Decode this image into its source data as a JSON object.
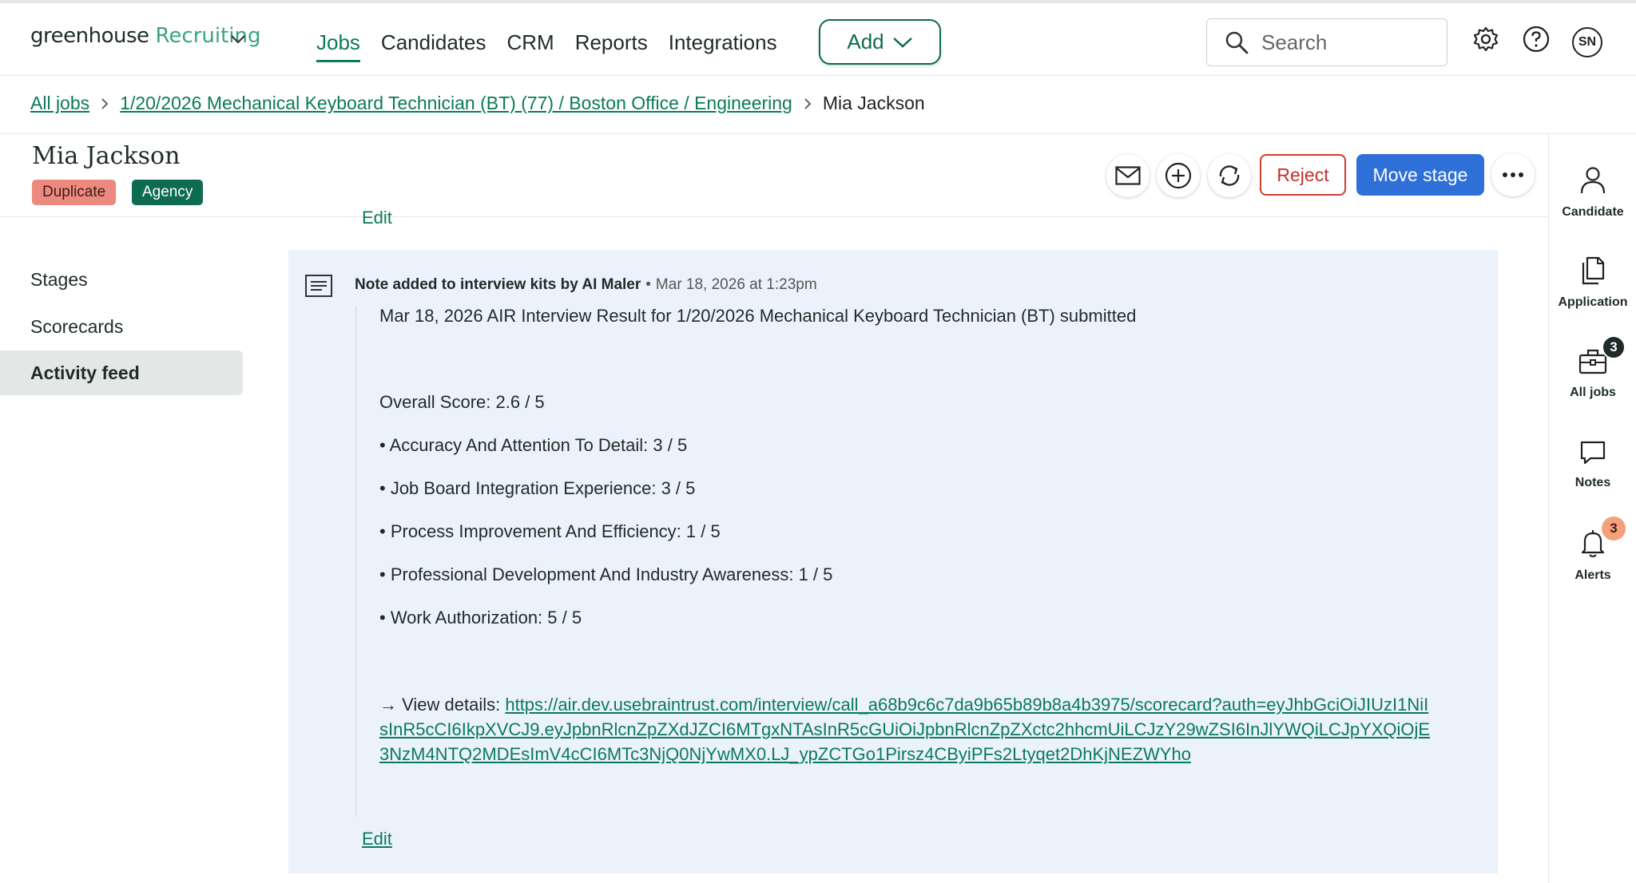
{
  "topnav": {
    "logo_word": "greenhouse",
    "logo_product": "Recruiting",
    "links": [
      "Jobs",
      "Candidates",
      "CRM",
      "Reports",
      "Integrations"
    ],
    "add_label": "Add",
    "search_placeholder": "Search",
    "avatar_initials": "SN"
  },
  "breadcrumb": {
    "all_jobs": "All jobs",
    "job": "1/20/2026 Mechanical Keyboard Technician (BT) (77) / Boston Office / Engineering",
    "current": "Mia Jackson"
  },
  "candidate": {
    "name": "Mia Jackson",
    "badges": [
      "Duplicate",
      "Agency"
    ],
    "reject_label": "Reject",
    "move_stage_label": "Move stage"
  },
  "sidebar": {
    "items": [
      "Stages",
      "Scorecards",
      "Activity feed"
    ],
    "active": "Activity feed"
  },
  "rail": {
    "items": [
      {
        "label": "Candidate",
        "icon": "person-icon"
      },
      {
        "label": "Application",
        "icon": "documents-icon"
      },
      {
        "label": "All jobs",
        "icon": "briefcase-icon",
        "badge": "3"
      },
      {
        "label": "Notes",
        "icon": "speech-bubble-icon"
      },
      {
        "label": "Alerts",
        "icon": "bell-icon",
        "badge": "3"
      }
    ]
  },
  "feed": {
    "edit_label": "Edit",
    "note": {
      "author": "Note added to interview kits by AI Maler",
      "separator": "•",
      "timestamp": "Mar 18, 2026 at 1:23pm",
      "title": "Mar 18, 2026 AIR Interview Result for 1/20/2026 Mechanical Keyboard Technician (BT) submitted",
      "overall": "Overall Score: 2.6 / 5",
      "scores": [
        "• Accuracy And Attention To Detail: 3 / 5",
        "• Job Board Integration Experience: 3 / 5",
        "• Process Improvement And Efficiency: 1 / 5",
        "• Professional Development And Industry Awareness: 1 / 5",
        "• Work Authorization: 5 / 5"
      ],
      "details_prefix": "→ View details: ",
      "details_url": "https://air.dev.usebraintrust.com/interview/call_a68b9c6c7da9b65b89b8a4b3975/scorecard?auth=eyJhbGciOiJIUzI1NiIsInR5cCI6IkpXVCJ9.eyJpbnRlcnZpZXdJZCI6MTgxNTAsInR5cGUiOiJpbnRlcnZpZXctc2hhcmUiLCJzY29wZSI6InJlYWQiLCJpYXQiOjE3NzM4NTQ2MDEsImV4cCI6MTc3NjQ0NjYwMX0.LJ_ypZCTGo1Pirsz4CByiPFs2Ltyqet2DhKjNEZWYho",
      "edit_label": "Edit"
    }
  }
}
